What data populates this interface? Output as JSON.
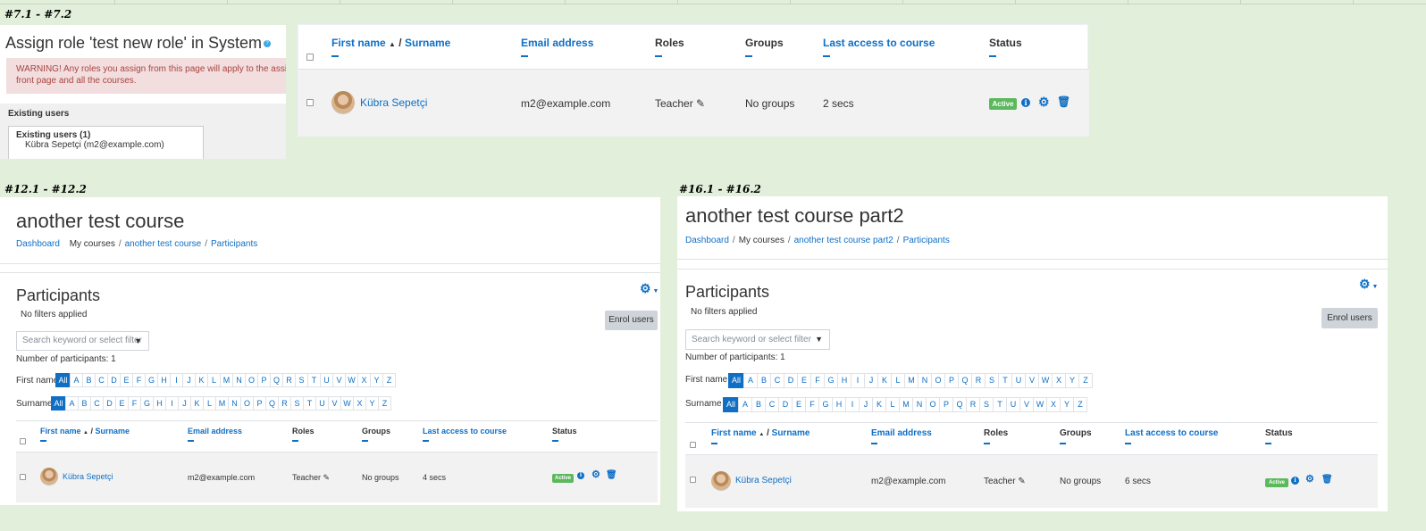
{
  "colors": {
    "background": "#e2efda",
    "link": "#0f6fc5",
    "badge_active": "#5cb85c",
    "warning_bg": "#f2dede",
    "warning_text": "#a94442"
  },
  "sections": {
    "s1": "#7.1 - #7.2",
    "s2": "#12.1 - #12.2",
    "s3": "#16.1 - #16.2"
  },
  "assign": {
    "title": "Assign role 'test new role' in System",
    "help_icon": "question-icon",
    "warning": "WARNING! Any roles you assign from this page will apply to the assigned users throughout the entire system, including the front page and all the courses.",
    "warning_line1": "WARNING! Any roles you assign from this page will apply to the assigned",
    "warning_line2": "front page and all the courses.",
    "existing_label": "Existing users",
    "existing_group": "Existing users (1)",
    "existing_entry": "Kübra Sepetçi (m2@example.com)"
  },
  "table": {
    "first_name": "First name",
    "sort_icon": "sort-up-icon",
    "separator": "/",
    "surname": "Surname",
    "email": "Email address",
    "roles": "Roles",
    "groups": "Groups",
    "last_access": "Last access to course",
    "status": "Status"
  },
  "user": {
    "name": "Kübra Sepetçi",
    "email": "m2@example.com",
    "role": "Teacher",
    "groups": "No groups",
    "status": "Active"
  },
  "panels": [
    {
      "last_access": "2 secs"
    },
    {
      "title": "another test course",
      "breadcrumb": [
        "Dashboard",
        "My courses",
        "another test course",
        "Participants"
      ],
      "last_access": "4 secs"
    },
    {
      "title": "another test course part2",
      "breadcrumb": [
        "Dashboard",
        "My courses",
        "another test course part2",
        "Participants"
      ],
      "last_access": "6 secs"
    }
  ],
  "participants": {
    "heading": "Participants",
    "filters": "No filters applied",
    "enrol": "Enrol users",
    "search_placeholder": "Search keyword or select filter",
    "count": "Number of participants: 1",
    "firstname_label": "First name",
    "surname_label": "Surname",
    "letters": [
      "All",
      "A",
      "B",
      "C",
      "D",
      "E",
      "F",
      "G",
      "H",
      "I",
      "J",
      "K",
      "L",
      "M",
      "N",
      "O",
      "P",
      "Q",
      "R",
      "S",
      "T",
      "U",
      "V",
      "W",
      "X",
      "Y",
      "Z"
    ]
  }
}
